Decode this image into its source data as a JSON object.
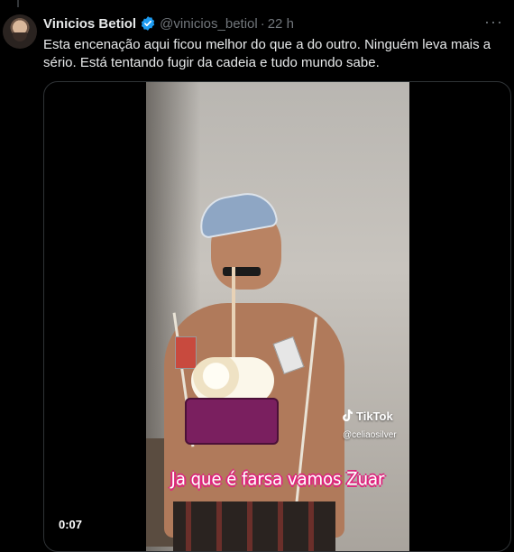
{
  "tweet": {
    "author_name": "Vinicios Betiol",
    "handle": "@vinicios_betiol",
    "separator": "·",
    "time": "22 h",
    "more_label": "···",
    "text": "Esta encenação aqui ficou melhor do que a do outro. Ninguém leva mais a sério. Está tentando fugir da cadeia e tudo mundo sabe."
  },
  "video": {
    "tiktok_label": "TikTok",
    "tiktok_handle": "@celiaosilver",
    "caption": "Ja que é farsa vamos Zuar",
    "timestamp": "0:07"
  },
  "icons": {
    "verified": "verified-badge-icon",
    "more": "more-icon",
    "tiktok": "tiktok-icon"
  },
  "colors": {
    "background": "#000000",
    "text": "#e7e9ea",
    "muted": "#71767b",
    "verified": "#1d9bf0",
    "border": "#2f3336",
    "caption_stroke": "#e0247f"
  }
}
